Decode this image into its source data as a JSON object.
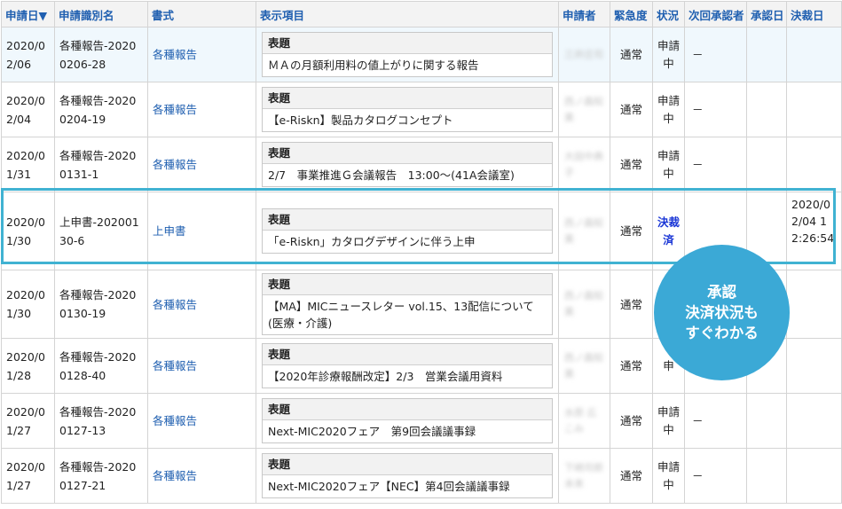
{
  "columns": [
    {
      "label": "申請日▼"
    },
    {
      "label": "申請識別名"
    },
    {
      "label": "書式"
    },
    {
      "label": "表示項目"
    },
    {
      "label": "申請者"
    },
    {
      "label": "緊急度"
    },
    {
      "label": "状況"
    },
    {
      "label": "次回承認者"
    },
    {
      "label": "承認日"
    },
    {
      "label": "決裁日"
    }
  ],
  "rows": [
    {
      "date": "2020/02/06",
      "code": "各種報告-20200206-28",
      "form": "各種報告",
      "item_label": "表題",
      "item_value": "ＭＡの月額利用料の値上がりに関する報告",
      "applicant": "三井庄司",
      "urgency": "通常",
      "status": "申請中",
      "next": "－",
      "approved": "",
      "decided": ""
    },
    {
      "date": "2020/02/04",
      "code": "各種報告-20200204-19",
      "form": "各種報告",
      "item_label": "表題",
      "item_value": "【e-Riskn】製品カタログコンセプト",
      "applicant": "西ノ森知美",
      "urgency": "通常",
      "status": "申請中",
      "next": "－",
      "approved": "",
      "decided": ""
    },
    {
      "date": "2020/01/31",
      "code": "各種報告-20200131-1",
      "form": "各種報告",
      "item_label": "表題",
      "item_value": "2/7　事業推進Ｇ会議報告　13:00～(41A会議室)",
      "applicant": "大田中典子",
      "urgency": "通常",
      "status": "申請中",
      "next": "－",
      "approved": "",
      "decided": ""
    },
    {
      "date": "2020/01/30",
      "code": "上申書-20200130-6",
      "form": "上申書",
      "item_label": "表題",
      "item_value": "「e-Riskn」カタログデザインに伴う上申",
      "applicant": "西ノ森知美",
      "urgency": "通常",
      "status": "決裁済",
      "next": "",
      "approved": "",
      "decided": "2020/02/04 12:26:54"
    },
    {
      "date": "2020/01/30",
      "code": "各種報告-20200130-19",
      "form": "各種報告",
      "item_label": "表題",
      "item_value": "【MA】MICニュースレター vol.15、13配信について(医療・介護)",
      "applicant": "西ノ森知美",
      "urgency": "通常",
      "status": "",
      "next": "",
      "approved": "",
      "decided": ""
    },
    {
      "date": "2020/01/28",
      "code": "各種報告-20200128-40",
      "form": "各種報告",
      "item_label": "表題",
      "item_value": "【2020年診療報酬改定】2/3　営業会議用資料",
      "applicant": "西ノ森知美",
      "urgency": "通常",
      "status": "申",
      "next": "",
      "approved": "",
      "decided": ""
    },
    {
      "date": "2020/01/27",
      "code": "各種報告-20200127-13",
      "form": "各種報告",
      "item_label": "表題",
      "item_value": "Next-MIC2020フェア　第9回会議議事録",
      "applicant": "水原 広こみ",
      "urgency": "通常",
      "status": "申請中",
      "next": "－",
      "approved": "",
      "decided": ""
    },
    {
      "date": "2020/01/27",
      "code": "各種報告-20200127-21",
      "form": "各種報告",
      "item_label": "表題",
      "item_value": "Next-MIC2020フェア【NEC】第4回会議議事録",
      "applicant": "下崎司郎未来",
      "urgency": "通常",
      "status": "申請中",
      "next": "－",
      "approved": "",
      "decided": ""
    }
  ],
  "callout": {
    "line1": "承認",
    "line2": "決済状況も",
    "line3": "すぐわかる"
  },
  "colors": {
    "header_text": "#1f5fb0",
    "link": "#1f5fb0",
    "highlight_border": "#40b2d2",
    "callout_bg": "#3ba9d6",
    "status_done": "#1a36d6"
  }
}
